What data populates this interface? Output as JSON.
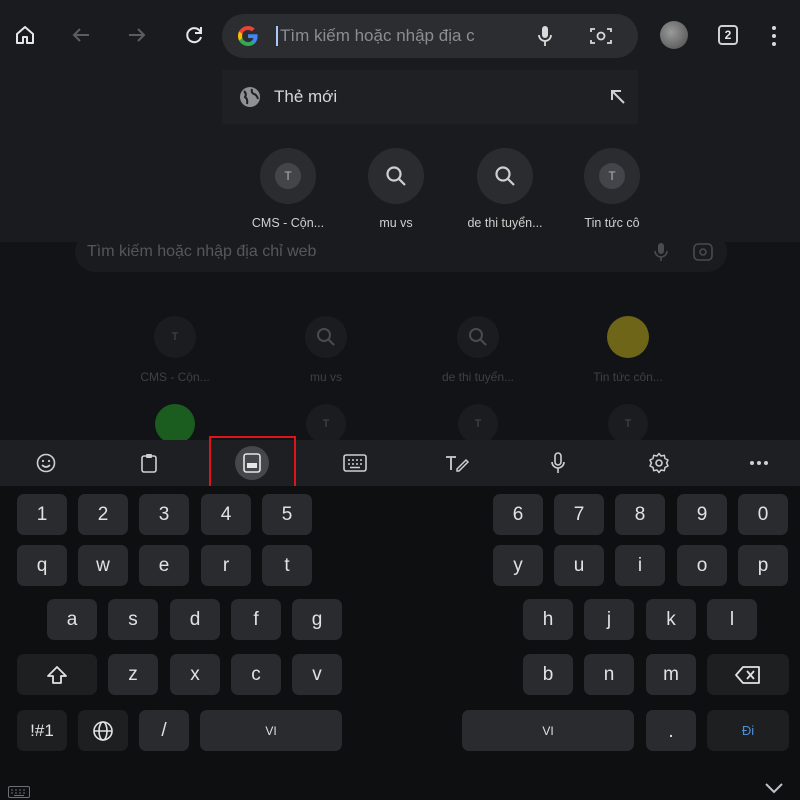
{
  "toolbar": {
    "search_placeholder": "Tìm kiếm hoặc nhập địa c",
    "tab_count": "2"
  },
  "suggestion": {
    "label": "Thẻ mới"
  },
  "dropdown_tiles": [
    {
      "label": "CMS - Cộn...",
      "icon": "letter-t-icon",
      "letter": "T"
    },
    {
      "label": "mu vs",
      "icon": "search-icon"
    },
    {
      "label": "de thi tuyển...",
      "icon": "search-icon"
    },
    {
      "label": "Tin tức cô",
      "icon": "letter-t-icon",
      "letter": "T"
    }
  ],
  "background_page": {
    "search_placeholder": "Tìm kiếm hoặc nhập địa chỉ web",
    "tiles": [
      {
        "label": "CMS - Cộn...",
        "letter": "T"
      },
      {
        "label": "mu vs"
      },
      {
        "label": "de thi tuyển..."
      },
      {
        "label": "Tin tức côn..."
      }
    ],
    "row2_letters": [
      "T",
      "T",
      "T"
    ]
  },
  "keyboard_toolbar": {
    "items": [
      "emoji-icon",
      "clipboard-icon",
      "split-keyboard-icon",
      "keyboard-icon",
      "handwriting-icon",
      "mic-icon",
      "settings-icon",
      "more-icon"
    ],
    "active_item": "split-keyboard-icon",
    "highlight_color": "#e0131b"
  },
  "keyboard": {
    "left_numbers": [
      "1",
      "2",
      "3",
      "4",
      "5"
    ],
    "right_numbers": [
      "6",
      "7",
      "8",
      "9",
      "0"
    ],
    "left_row1": [
      "q",
      "w",
      "e",
      "r",
      "t"
    ],
    "right_row1": [
      "y",
      "u",
      "i",
      "o",
      "p"
    ],
    "left_row2": [
      "a",
      "s",
      "d",
      "f",
      "g"
    ],
    "right_row2": [
      "h",
      "j",
      "k",
      "l"
    ],
    "left_row3": [
      "z",
      "x",
      "c",
      "v"
    ],
    "right_row3": [
      "b",
      "n",
      "m"
    ],
    "symbols_key": "!#1",
    "slash_key": "/",
    "space_left": "VI",
    "space_right": "VI",
    "period_key": ".",
    "enter_key": "Đi"
  },
  "colors": {
    "accent": "#4f8fd8",
    "highlight": "#e0131b"
  }
}
